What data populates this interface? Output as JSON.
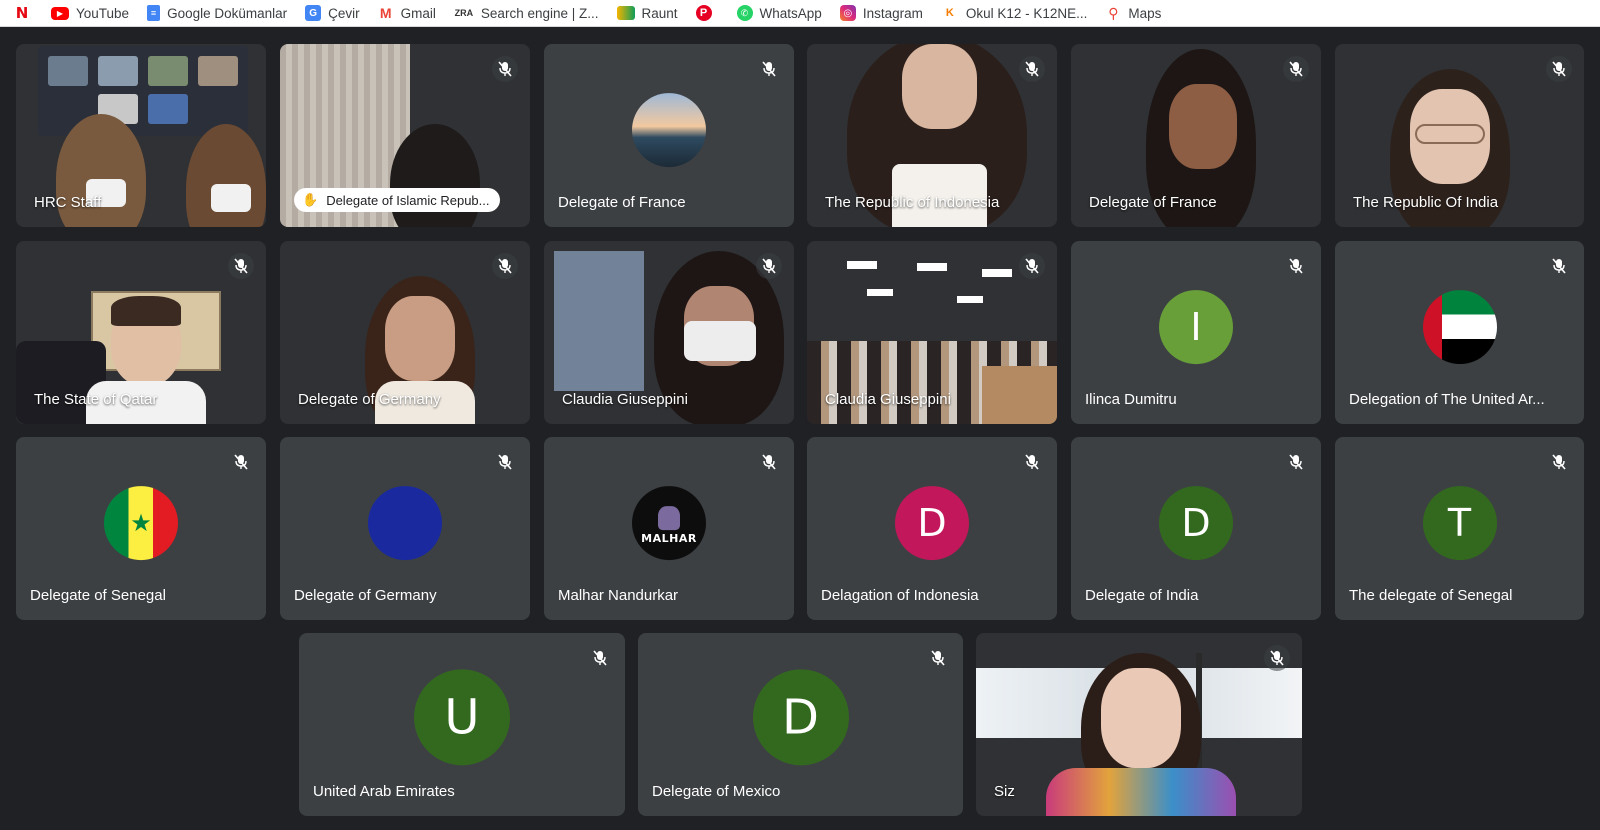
{
  "bookmarks": [
    {
      "label": "",
      "icon": "netflix-icon",
      "color": "#e50914"
    },
    {
      "label": "YouTube",
      "icon": "youtube-icon",
      "color": "#ff0000"
    },
    {
      "label": "Google Dokümanlar",
      "icon": "google-docs-icon",
      "color": "#4285f4"
    },
    {
      "label": "Çevir",
      "icon": "google-translate-icon",
      "color": "#4285f4"
    },
    {
      "label": "Gmail",
      "icon": "gmail-icon",
      "color": "#ea4335"
    },
    {
      "label": "Search engine | Z...",
      "icon": "zara-icon",
      "color": "#333333"
    },
    {
      "label": "Raunt",
      "icon": "raunt-icon",
      "color": "#e0a800"
    },
    {
      "label": "",
      "icon": "pinterest-icon",
      "color": "#e60023"
    },
    {
      "label": "WhatsApp",
      "icon": "whatsapp-icon",
      "color": "#25d366"
    },
    {
      "label": "Instagram",
      "icon": "instagram-icon",
      "color": "#c13584"
    },
    {
      "label": "Okul K12 - K12NE...",
      "icon": "k12-icon",
      "color": "#f57c00"
    },
    {
      "label": "Maps",
      "icon": "maps-icon",
      "color": "#34a853"
    }
  ],
  "participants": [
    {
      "name": "HRC Staff",
      "kind": "video"
    },
    {
      "name": "Delegate of Islamic Repub...",
      "kind": "video",
      "status": "hand-raised"
    },
    {
      "name": "Delegate of France",
      "kind": "avatar",
      "avatar": "landscape-photo"
    },
    {
      "name": "The Republic of Indonesia",
      "kind": "video"
    },
    {
      "name": "Delegate of France",
      "kind": "video"
    },
    {
      "name": "The Republic Of India",
      "kind": "video"
    },
    {
      "name": "The State of Qatar",
      "kind": "video"
    },
    {
      "name": "Delegate of Germany",
      "kind": "video"
    },
    {
      "name": "Claudia Giuseppini",
      "kind": "video"
    },
    {
      "name": "Claudia Giuseppini",
      "kind": "video"
    },
    {
      "name": "Ilinca Dumitru",
      "kind": "avatar",
      "initial": "I",
      "color": "#689f38"
    },
    {
      "name": "Delegation of The United Ar...",
      "kind": "avatar",
      "avatar": "uae-flag"
    },
    {
      "name": "Delegate of Senegal",
      "kind": "avatar",
      "avatar": "senegal-flag"
    },
    {
      "name": "Delegate of Germany",
      "kind": "avatar",
      "avatar": "blue-circle",
      "color": "#1a2a9e"
    },
    {
      "name": "Malhar Nandurkar",
      "kind": "avatar",
      "avatar": "malhar-logo",
      "logo_text": "MALHAR"
    },
    {
      "name": "Delagation of Indonesia",
      "kind": "avatar",
      "initial": "D",
      "color": "#c2185b"
    },
    {
      "name": "Delegate of India",
      "kind": "avatar",
      "initial": "D",
      "color": "#33691e"
    },
    {
      "name": "The delegate of Senegal",
      "kind": "avatar",
      "initial": "T",
      "color": "#33691e"
    },
    {
      "name": "United Arab Emirates",
      "kind": "avatar",
      "initial": "U",
      "color": "#33691e"
    },
    {
      "name": "Delegate of Mexico",
      "kind": "avatar",
      "initial": "D",
      "color": "#33691e"
    },
    {
      "name": "Siz",
      "kind": "video",
      "self": true
    }
  ]
}
